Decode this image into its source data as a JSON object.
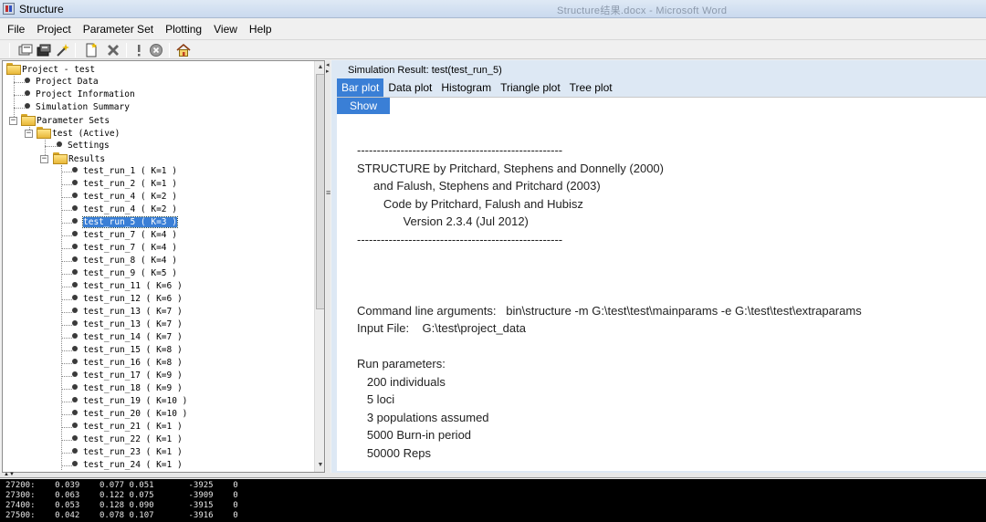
{
  "window": {
    "title": "Structure",
    "background_title": "Structure结果.docx - Microsoft Word"
  },
  "menu": [
    "File",
    "Project",
    "Parameter Set",
    "Plotting",
    "View",
    "Help"
  ],
  "toolbar": [
    "new-project-icon",
    "open-project-icon",
    "wizard-icon",
    "new-document-icon",
    "delete-icon",
    "warning-icon",
    "stop-icon",
    "home-icon"
  ],
  "tree": {
    "root": "Project - test",
    "items": {
      "project_data": "Project Data",
      "project_information": "Project Information",
      "simulation_summary": "Simulation Summary",
      "parameter_sets": "Parameter Sets",
      "test_active": "test (Active)",
      "settings": "Settings",
      "results": "Results"
    },
    "runs": [
      "test_run_1 ( K=1 )",
      "test_run_2 ( K=1 )",
      "test_run_4 ( K=2 )",
      "test_run_4 ( K=2 )",
      "test_run_5 ( K=3 )",
      "test_run_7 ( K=4 )",
      "test_run_7 ( K=4 )",
      "test_run_8 ( K=4 )",
      "test_run_9 ( K=5 )",
      "test_run_11 ( K=6 )",
      "test_run_12 ( K=6 )",
      "test_run_13 ( K=7 )",
      "test_run_13 ( K=7 )",
      "test_run_14 ( K=7 )",
      "test_run_15 ( K=8 )",
      "test_run_16 ( K=8 )",
      "test_run_17 ( K=9 )",
      "test_run_18 ( K=9 )",
      "test_run_19 ( K=10 )",
      "test_run_20 ( K=10 )",
      "test_run_21 ( K=1 )",
      "test_run_22 ( K=1 )",
      "test_run_23 ( K=1 )",
      "test_run_24 ( K=1 )"
    ],
    "selected_run_index": 4
  },
  "result": {
    "header": "Simulation Result: test(test_run_5)",
    "tabs": [
      "Bar plot",
      "Data plot",
      "Histogram",
      "Triangle plot",
      "Tree plot"
    ],
    "active_tab": 0,
    "show_button": "Show",
    "output_lines": [
      "----------------------------------------------------",
      "STRUCTURE by Pritchard, Stephens and Donnelly (2000)",
      "     and Falush, Stephens and Pritchard (2003)",
      "        Code by Pritchard, Falush and Hubisz",
      "              Version 2.3.4 (Jul 2012)",
      "----------------------------------------------------",
      "",
      "",
      "",
      "Command line arguments:   bin\\structure -m G:\\test\\test\\mainparams -e G:\\test\\test\\extraparams",
      "Input File:    G:\\test\\project_data",
      "",
      "Run parameters:",
      "   200 individuals",
      "   5 loci",
      "   3 populations assumed",
      "   5000 Burn-in period",
      "   50000 Reps"
    ]
  },
  "console": {
    "lines": [
      "27200:    0.039    0.077 0.051       -3925    0",
      "27300:    0.063    0.122 0.075       -3909    0",
      "27400:    0.053    0.128 0.090       -3915    0",
      "27500:    0.042    0.078 0.107       -3916    0"
    ]
  }
}
